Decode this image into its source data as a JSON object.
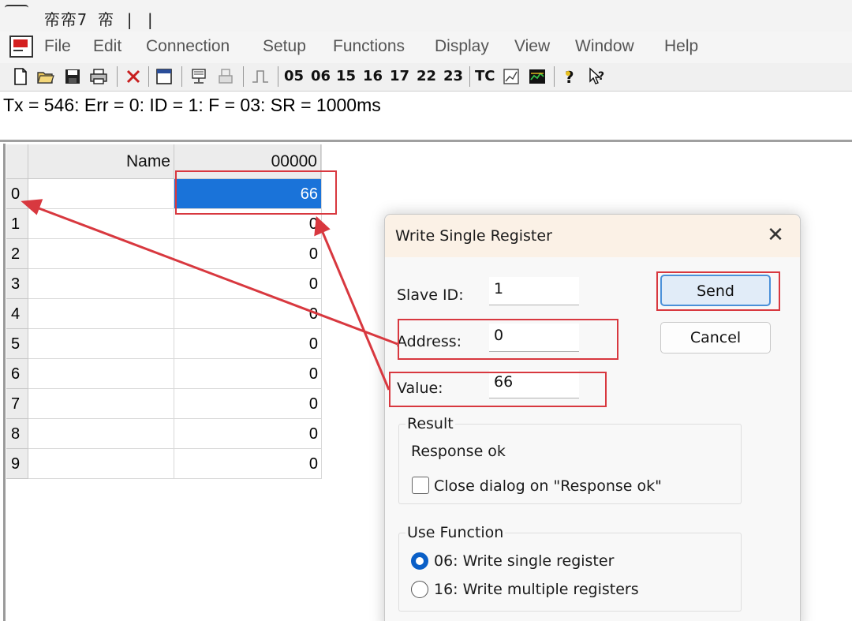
{
  "window": {
    "title_glyphs": "帟帟7 帟 |   |"
  },
  "menu": {
    "items": [
      "File",
      "Edit",
      "Connection",
      "Setup",
      "Functions",
      "Display",
      "View",
      "Window",
      "Help"
    ]
  },
  "toolbar": {
    "icons": [
      "new-file-icon",
      "open-folder-icon",
      "save-icon",
      "print-icon",
      "disconnect-icon",
      "window-icon",
      "connect-icon",
      "disconnect-printer-icon",
      "pulse-icon",
      "test-center-icon",
      "monitor-icon",
      "help-icon",
      "context-help-icon"
    ],
    "function_codes": [
      "05",
      "06",
      "15",
      "16",
      "17",
      "22",
      "23"
    ],
    "tc_label": "TC"
  },
  "status": {
    "text": "Tx = 546: Err = 0: ID = 1: F = 03: SR = 1000ms"
  },
  "grid": {
    "name_header": "Name",
    "address_header": "00000",
    "rows": [
      {
        "index": "0",
        "value": "66"
      },
      {
        "index": "1",
        "value": "0"
      },
      {
        "index": "2",
        "value": "0"
      },
      {
        "index": "3",
        "value": "0"
      },
      {
        "index": "4",
        "value": "0"
      },
      {
        "index": "5",
        "value": "0"
      },
      {
        "index": "6",
        "value": "0"
      },
      {
        "index": "7",
        "value": "0"
      },
      {
        "index": "8",
        "value": "0"
      },
      {
        "index": "9",
        "value": "0"
      }
    ]
  },
  "dialog": {
    "title": "Write Single Register",
    "close_glyph": "✕",
    "slave_id_label": "Slave ID:",
    "slave_id_value": "1",
    "address_label": "Address:",
    "address_value": "0",
    "value_label": "Value:",
    "value_value": "66",
    "send_label": "Send",
    "cancel_label": "Cancel",
    "result_title": "Result",
    "result_text": "Response ok",
    "close_on_ok_label": "Close dialog on \"Response ok\"",
    "close_on_ok_checked": false,
    "use_function_title": "Use Function",
    "function_options": [
      {
        "label": "06: Write single register",
        "selected": true
      },
      {
        "label": "16: Write multiple registers",
        "selected": false
      }
    ]
  },
  "colors": {
    "annotation_red": "#d8383f",
    "selection_blue": "#1a73d9",
    "radio_blue": "#0a5fc7"
  }
}
